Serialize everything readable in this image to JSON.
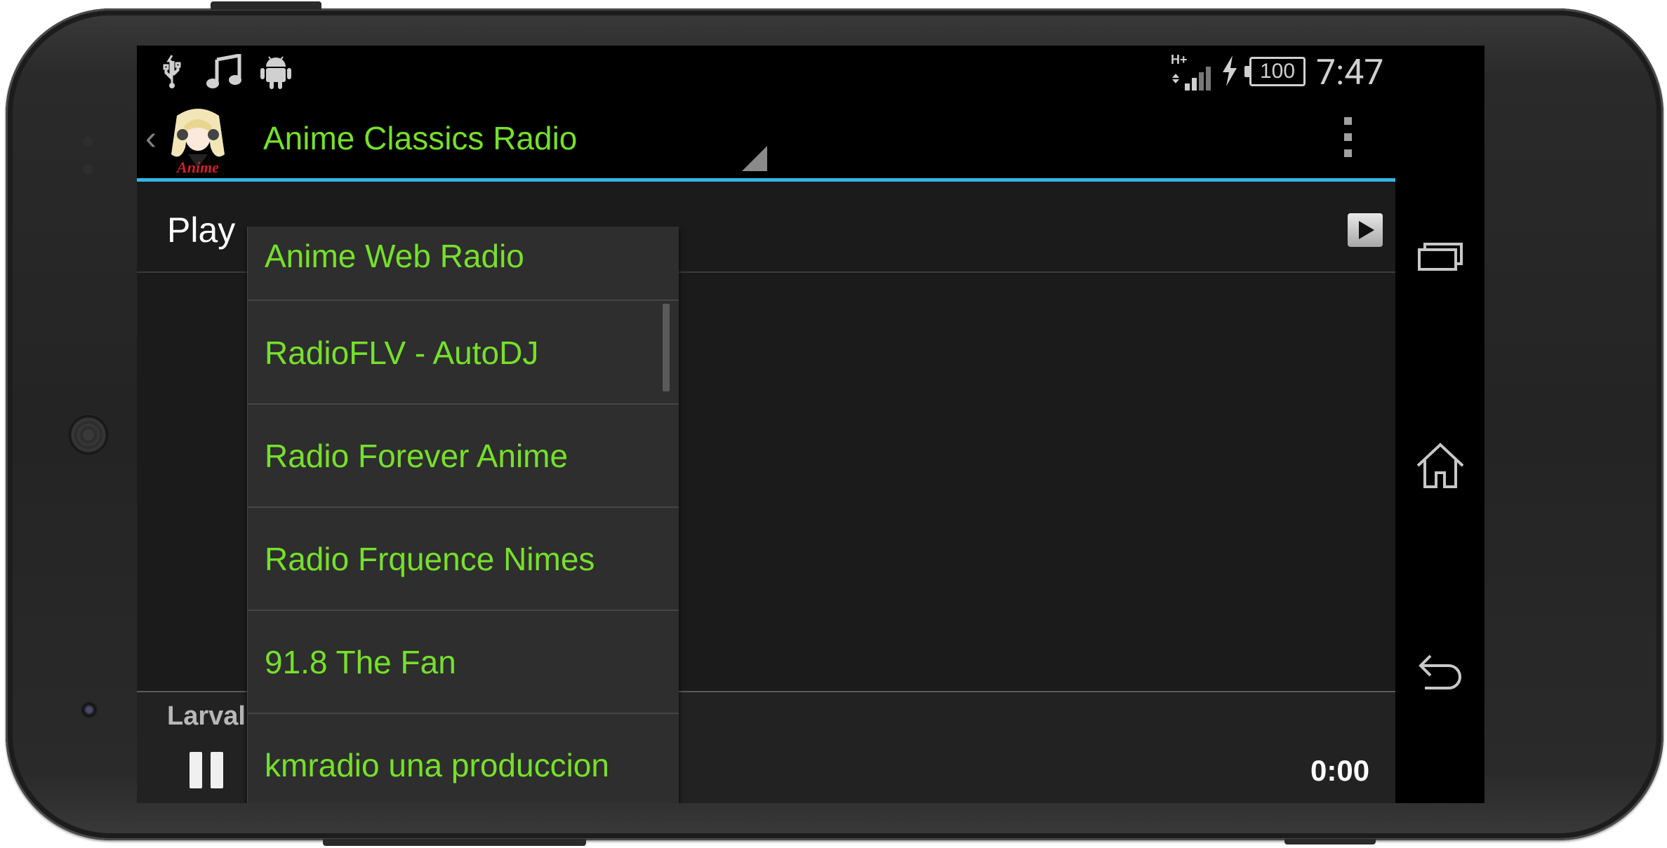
{
  "status_bar": {
    "left_icons": [
      "usb-icon",
      "music-note-icon",
      "android-icon"
    ],
    "network": "H+",
    "battery": "100",
    "time": "7:47"
  },
  "action_bar": {
    "selected_station": "Anime Classics Radio",
    "logo_text": "Anime",
    "accent_color": "#33b5e5",
    "text_color": "#76e02a"
  },
  "content": {
    "play_label": "Play",
    "track_label": "Larval",
    "time": "0:00"
  },
  "dropdown": {
    "items": [
      {
        "label": "Anime Web Radio"
      },
      {
        "label": "RadioFLV - AutoDJ"
      },
      {
        "label": "Radio Forever Anime"
      },
      {
        "label": "Radio Frquence Nimes"
      },
      {
        "label": "91.8 The Fan"
      },
      {
        "label": "kmradio una produccion"
      }
    ]
  },
  "nav_bar": {
    "buttons": [
      "recent-apps",
      "home",
      "back"
    ]
  }
}
